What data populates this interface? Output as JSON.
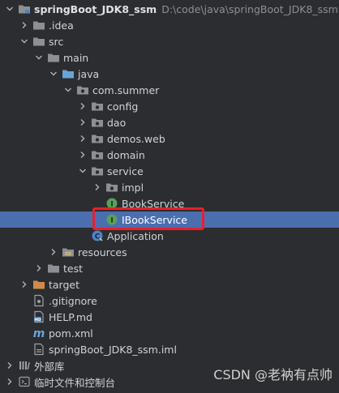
{
  "project": {
    "name": "springBoot_JDK8_ssm",
    "path": "D:\\code\\java\\springBoot_JDK8_ssm"
  },
  "tree": {
    "idea": ".idea",
    "src": "src",
    "main": "main",
    "java": "java",
    "package": "com.summer",
    "config": "config",
    "dao": "dao",
    "demos_web": "demos.web",
    "domain": "domain",
    "service": "service",
    "impl": "impl",
    "book_service": "BookService",
    "ibook_service": "IBookService",
    "application": "Application",
    "resources": "resources",
    "test": "test",
    "target": "target",
    "gitignore": ".gitignore",
    "help_md": "HELP.md",
    "pom_xml": "pom.xml",
    "iml": "springBoot_JDK8_ssm.iml",
    "external_libs": "外部库",
    "scratches": "临时文件和控制台"
  },
  "icons": {
    "folder": "folder-icon",
    "package": "package-icon",
    "interface": "interface-icon",
    "class": "class-icon",
    "file": "file-icon",
    "markdown": "markdown-icon",
    "maven": "maven-icon",
    "libraries": "libraries-icon",
    "scratches": "scratches-icon"
  },
  "colors": {
    "background": "#2b2d30",
    "selection": "#4b6eaf",
    "highlight_border": "#e8202a",
    "folder": "#8c9096",
    "java_folder": "#6aa3d8",
    "target_folder": "#d08a4a",
    "interface_green": "#5aa05a"
  },
  "watermark": "CSDN @老衲有点帅"
}
